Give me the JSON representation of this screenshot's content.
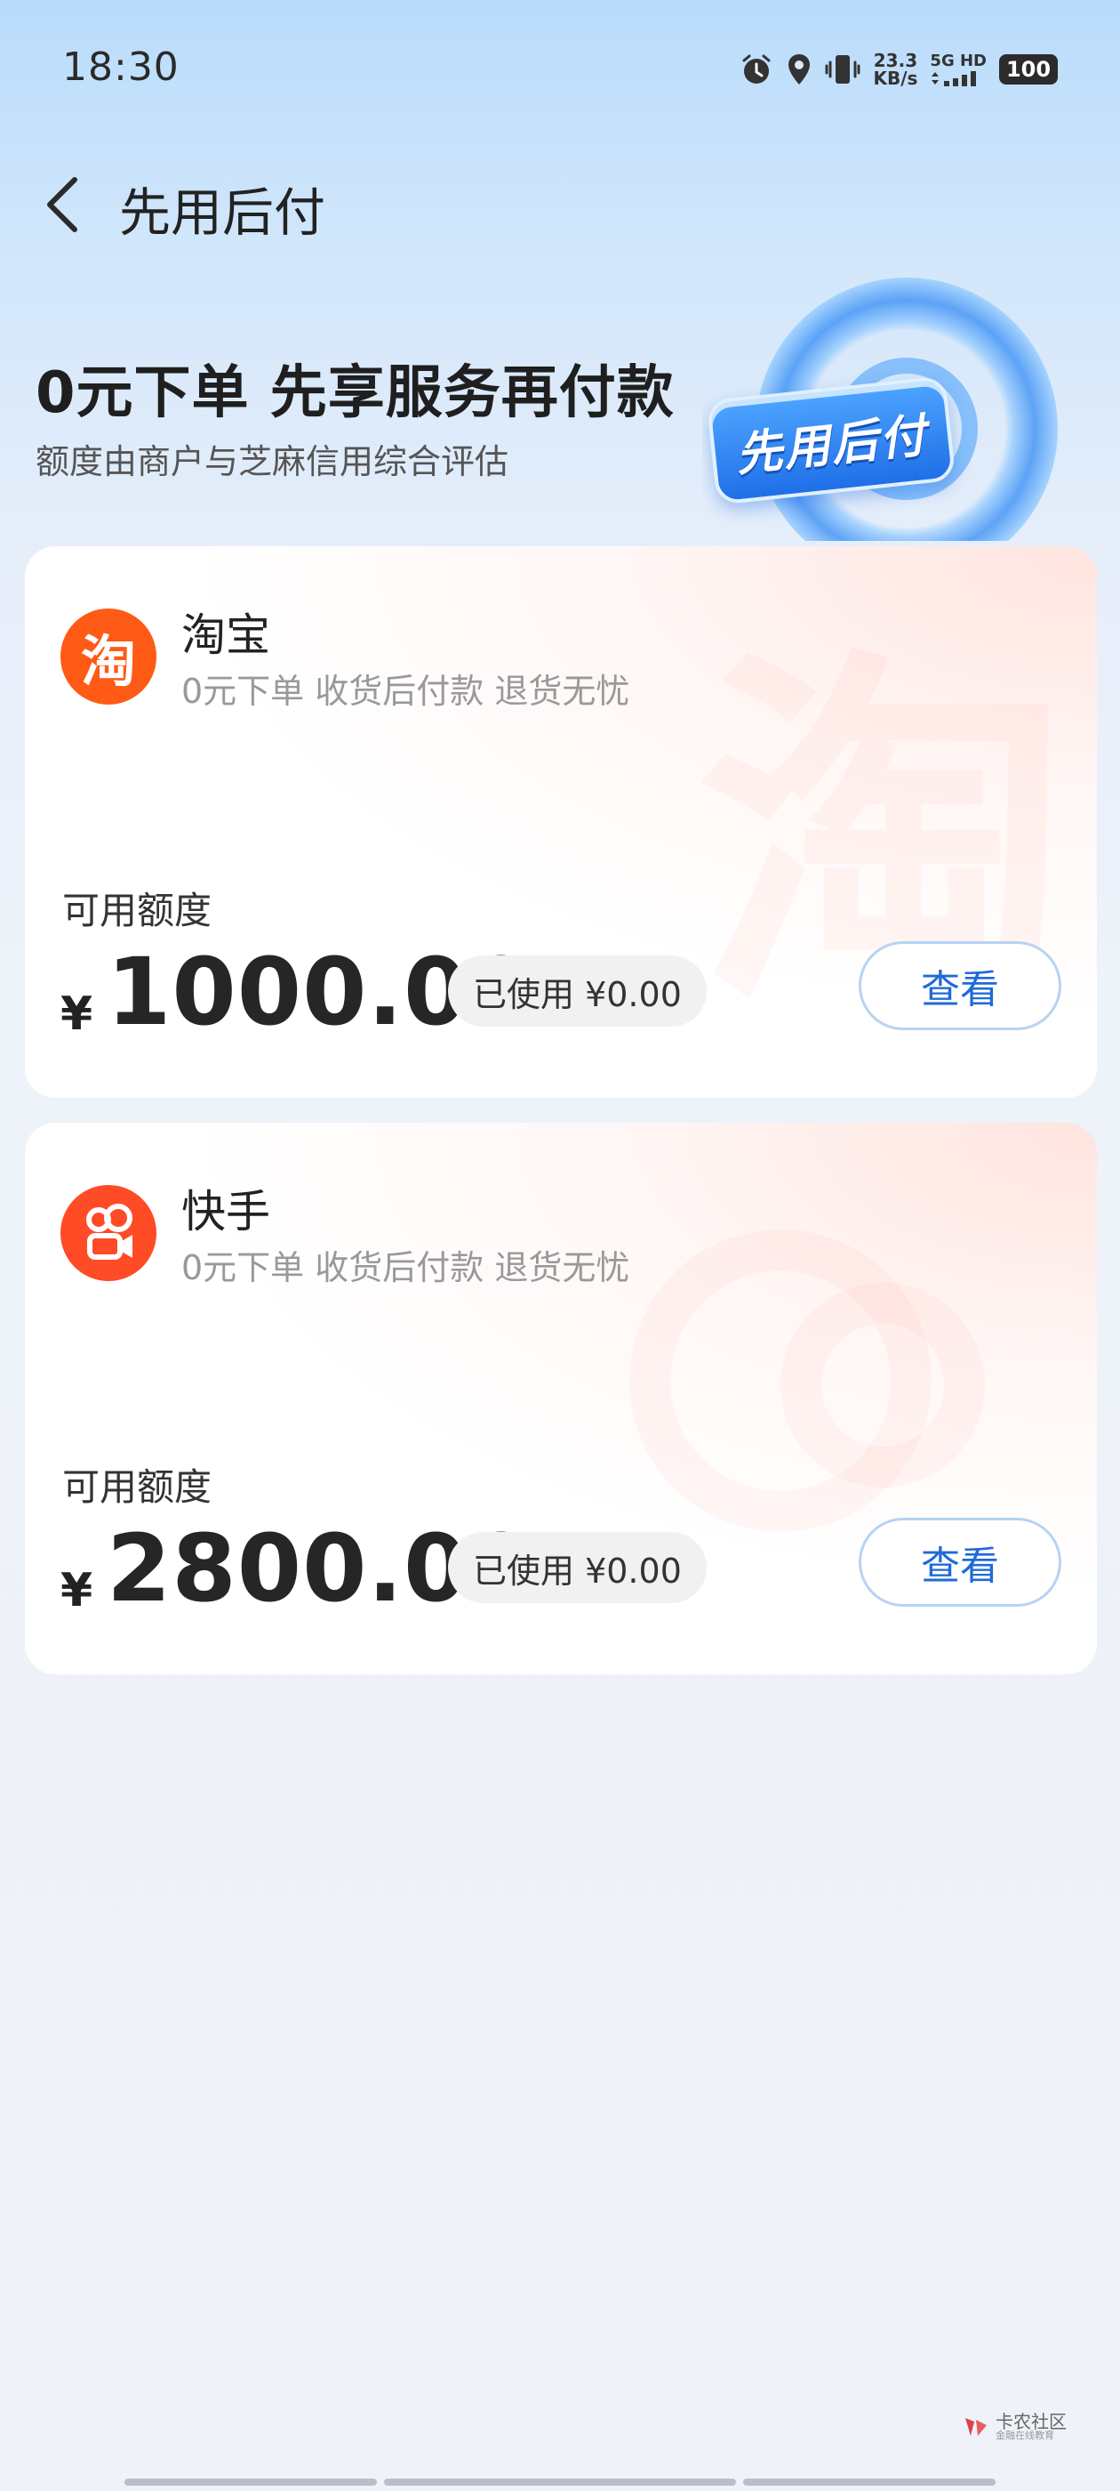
{
  "status_bar": {
    "time": "18:30",
    "net_speed_value": "23.3",
    "net_speed_unit": "KB/s",
    "network_label": "5G HD",
    "battery": "100",
    "icons": [
      "alarm-icon",
      "location-icon",
      "vibrate-icon",
      "signal-icon"
    ]
  },
  "nav": {
    "title": "先用后付"
  },
  "hero": {
    "title": "0元下单 先享服务再付款",
    "subtitle": "额度由商户与芝麻信用综合评估",
    "badge_text": "先用后付"
  },
  "merchants": [
    {
      "name": "淘宝",
      "logo_glyph": "淘",
      "description": "0元下单 收货后付款 退货无忧",
      "limit_label": "可用额度",
      "currency": "¥",
      "amount": "1000.00",
      "used": "已使用 ¥0.00",
      "button": "查看",
      "brand_color": "#ff5a16"
    },
    {
      "name": "快手",
      "logo_glyph": "",
      "description": "0元下单 收货后付款 退货无忧",
      "limit_label": "可用额度",
      "currency": "¥",
      "amount": "2800.00",
      "used": "已使用 ¥0.00",
      "button": "查看",
      "brand_color": "#ff4b26"
    }
  ],
  "footer": {
    "watermark_title": "卡农社区",
    "watermark_sub": "金融在线教育"
  },
  "colors": {
    "accent": "#1f6ad8",
    "button_border": "#b6d3f2"
  }
}
